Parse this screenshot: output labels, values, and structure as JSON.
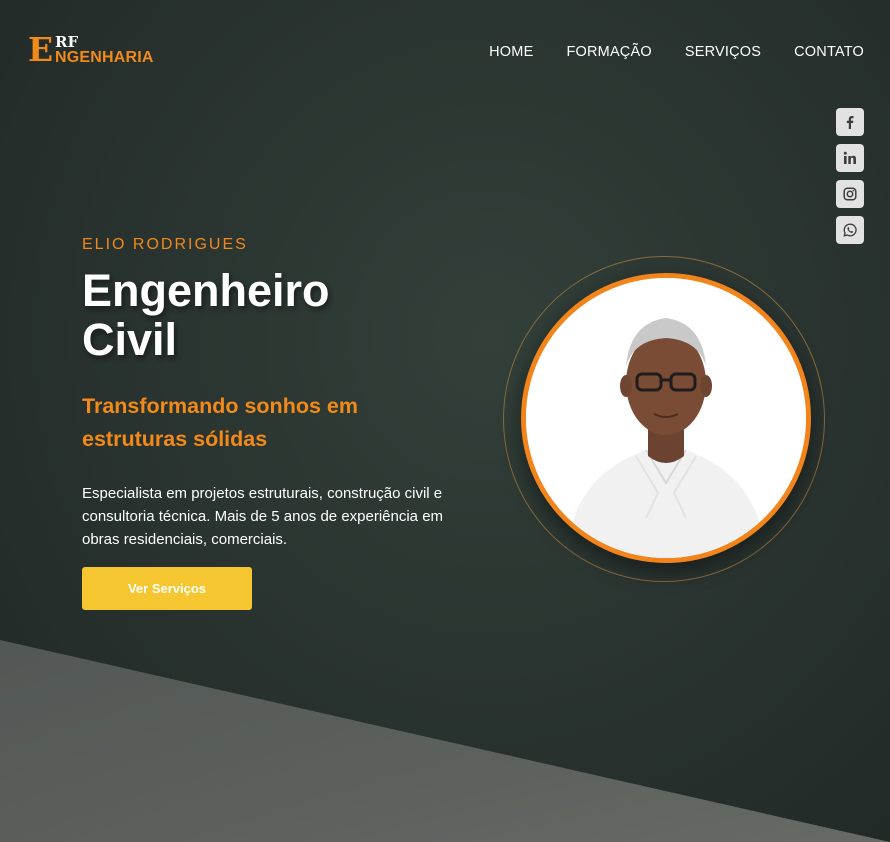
{
  "logo": {
    "letter_e": "E",
    "rf": "RF",
    "wordmark": "NGENHARIA"
  },
  "nav": [
    "HOME",
    "FORMAÇÃO",
    "SERVIÇOS",
    "CONTATO"
  ],
  "social": [
    {
      "icon": "facebook-icon",
      "glyph": "f"
    },
    {
      "icon": "linkedin-icon",
      "glyph": "in"
    },
    {
      "icon": "instagram-icon"
    },
    {
      "icon": "whatsapp-icon"
    }
  ],
  "hero": {
    "eyebrow": "ELIO RODRIGUES",
    "title_line1": "Engenheiro",
    "title_line2": "Civil",
    "subtitle": "Transformando sonhos em estruturas sólidas",
    "description": "Especialista em projetos estruturais, construção civil e consultoria técnica. Mais de 5 anos de experiência em obras residenciais, comerciais.",
    "cta": "Ver Serviços"
  },
  "colors": {
    "accent_orange": "#f28a1a",
    "cta_yellow": "#f5c62f",
    "background": "#2a3430"
  }
}
